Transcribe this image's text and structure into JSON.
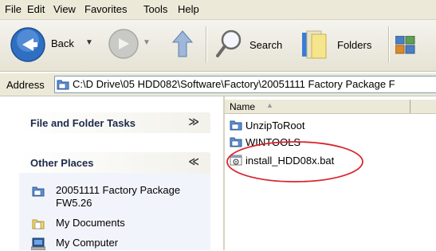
{
  "menubar": {
    "items": [
      "File",
      "Edit",
      "View",
      "Favorites",
      "Tools",
      "Help"
    ]
  },
  "toolbar": {
    "back_label": "Back",
    "search_label": "Search",
    "folders_label": "Folders"
  },
  "address": {
    "label": "Address",
    "value": "C:\\D Drive\\05 HDD082\\Software\\Factory\\20051111 Factory Package F"
  },
  "tasks": {
    "file_folder_title": "File and Folder Tasks",
    "other_places_title": "Other Places",
    "places": [
      "20051111 Factory Package",
      "FW5.26",
      "My Documents",
      "My Computer"
    ]
  },
  "list": {
    "column_name": "Name",
    "files": [
      {
        "name": "UnzipToRoot",
        "type": "folder"
      },
      {
        "name": "WINTOOLS",
        "type": "folder"
      },
      {
        "name": "install_HDD08x.bat",
        "type": "batch"
      }
    ]
  },
  "colors": {
    "highlight_ellipse": "#d9262b",
    "task_header_text": "#1c2a4a",
    "folder": "#f3d46a"
  }
}
